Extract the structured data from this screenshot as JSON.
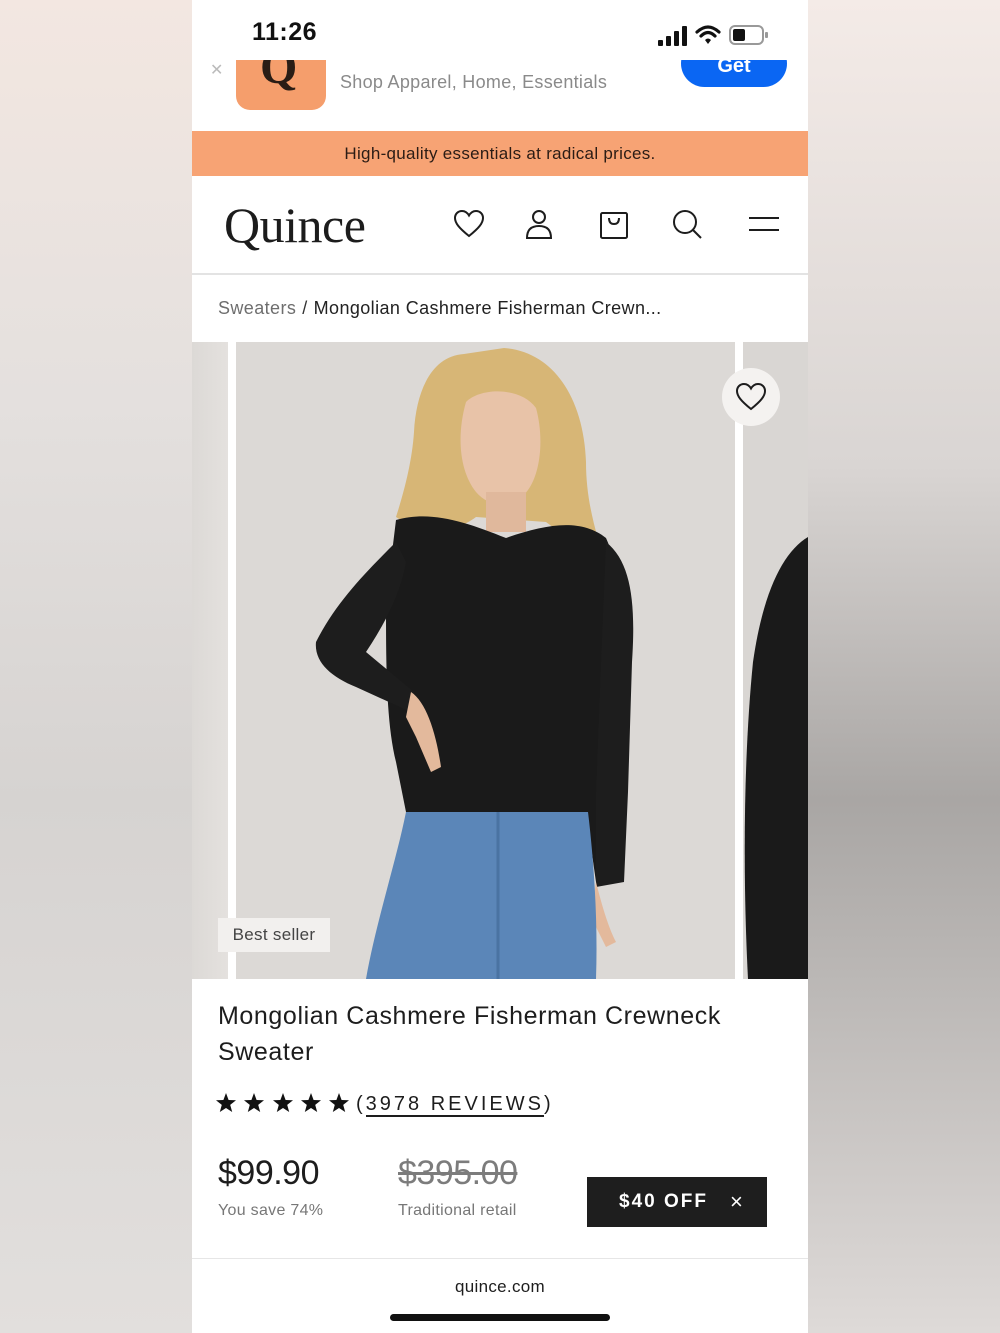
{
  "status_bar": {
    "time": "11:26"
  },
  "app_banner": {
    "subtitle": "Shop Apparel, Home, Essentials",
    "get_label": "Get",
    "icon_letter": "Q"
  },
  "promo": {
    "text": "High-quality essentials at radical prices."
  },
  "header": {
    "logo": "Quince",
    "icons": [
      "heart-icon",
      "account-icon",
      "bag-icon",
      "search-icon",
      "menu-icon"
    ]
  },
  "breadcrumb": {
    "category": "Sweaters",
    "separator": "/",
    "current": "Mongolian Cashmere Fisherman Crewn..."
  },
  "gallery": {
    "badge": "Best seller"
  },
  "product": {
    "title": "Mongolian Cashmere Fisherman Crewneck Sweater",
    "rating_open": "(",
    "reviews": "3978 REVIEWS",
    "rating_close": ")",
    "star_count": 5,
    "price": "$99.90",
    "savings": "You save 74%",
    "traditional_price": "$395.00",
    "traditional_label": "Traditional retail",
    "discount_label": "$40 OFF",
    "discount_close": "×"
  },
  "browser": {
    "url": "quince.com"
  },
  "colors": {
    "promo_bg": "#f7a374",
    "app_icon": "#f59e6c",
    "get_button": "#0a66f3",
    "offer_button": "#1e1e1e"
  }
}
